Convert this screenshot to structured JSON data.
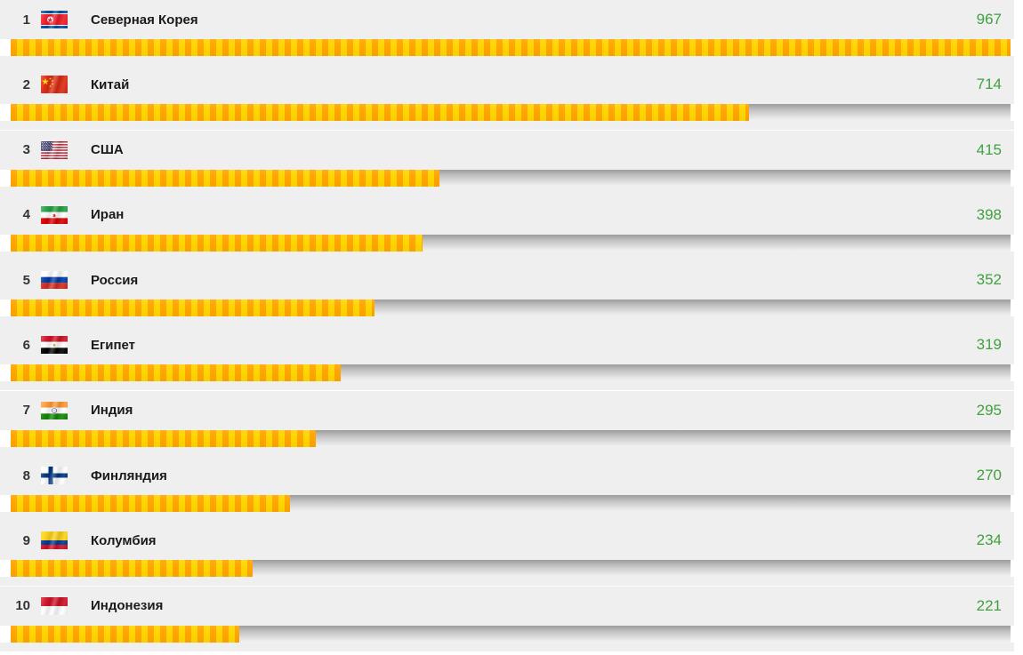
{
  "chart_data": {
    "type": "bar",
    "title": "",
    "xlabel": "",
    "ylabel": "",
    "orientation": "horizontal",
    "max_value": 967,
    "axis_max": 967,
    "grid": false,
    "legend": "none",
    "categories": [
      "Северная Корея",
      "Китай",
      "США",
      "Иран",
      "Россия",
      "Египет",
      "Индия",
      "Финляндия",
      "Колумбия",
      "Индонезия"
    ],
    "values": [
      967,
      714,
      415,
      398,
      352,
      319,
      295,
      270,
      234,
      221
    ],
    "ranks": [
      1,
      2,
      3,
      4,
      5,
      6,
      7,
      8,
      9,
      10
    ]
  },
  "style": {
    "value_color": "#3fa13f",
    "bar_color_dark": "#ffa500",
    "bar_color_light": "#ffd500",
    "row_bg": "#efefef",
    "track_top": "#9d9d9d",
    "track_bottom": "#f2f2f2",
    "rank_color": "#333333",
    "name_color": "#1a1a1a"
  },
  "rows": [
    {
      "rank": "1",
      "country": "Северная Корея",
      "value": "967",
      "percent": 100.0,
      "flag": "flag-north-korea"
    },
    {
      "rank": "2",
      "country": "Китай",
      "value": "714",
      "percent": 73.8,
      "flag": "flag-china"
    },
    {
      "rank": "3",
      "country": "США",
      "value": "415",
      "percent": 42.9,
      "flag": "flag-usa"
    },
    {
      "rank": "4",
      "country": "Иран",
      "value": "398",
      "percent": 41.2,
      "flag": "flag-iran"
    },
    {
      "rank": "5",
      "country": "Россия",
      "value": "352",
      "percent": 36.4,
      "flag": "flag-russia"
    },
    {
      "rank": "6",
      "country": "Египет",
      "value": "319",
      "percent": 33.0,
      "flag": "flag-egypt"
    },
    {
      "rank": "7",
      "country": "Индия",
      "value": "295",
      "percent": 30.5,
      "flag": "flag-india"
    },
    {
      "rank": "8",
      "country": "Финляндия",
      "value": "270",
      "percent": 27.9,
      "flag": "flag-finland"
    },
    {
      "rank": "9",
      "country": "Колумбия",
      "value": "234",
      "percent": 24.2,
      "flag": "flag-colombia"
    },
    {
      "rank": "10",
      "country": "Индонезия",
      "value": "221",
      "percent": 22.9,
      "flag": "flag-indonesia"
    }
  ]
}
